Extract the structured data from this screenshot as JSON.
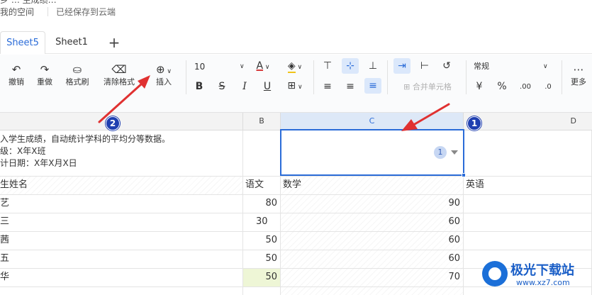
{
  "topbar": {
    "cut_text": "乡 … 生成绩…",
    "space": "我的空间",
    "saved": "已经保存到云端"
  },
  "tabs": [
    {
      "label": "Sheet5",
      "active": true
    },
    {
      "label": "Sheet1",
      "active": false
    }
  ],
  "add_tab_symbol": "+",
  "toolbar": {
    "undo": "撤销",
    "redo": "重做",
    "format_painter": "格式刷",
    "clear_format": "清除格式",
    "insert": "插入",
    "font_size": "10",
    "merge": "合并单元格",
    "number_format": "常规",
    "currency": "¥",
    "percent": "%",
    "decimal_inc": ".00",
    "decimal_dec": ".0",
    "more": "更多",
    "font_color": "#d63b3b",
    "fill_color": "#f0c419"
  },
  "columns": [
    {
      "label": "B"
    },
    {
      "label": "C"
    },
    {
      "label": "D"
    }
  ],
  "intro": [
    "入学生成绩，自动统计学科的平均分等数据。",
    "级：X年X班",
    "计日期：X年X月X日"
  ],
  "header_row": {
    "name": "生姓名",
    "chinese": "语文",
    "math": "数学",
    "english": "英语"
  },
  "rows": [
    {
      "name": "艺",
      "chinese": "80",
      "math": "90"
    },
    {
      "name": "三",
      "chinese": "30",
      "math": "60"
    },
    {
      "name": "茜",
      "chinese": "50",
      "math": "60"
    },
    {
      "name": "五",
      "chinese": "50",
      "math": "60"
    },
    {
      "name": "华",
      "chinese": "50",
      "math": "70"
    }
  ],
  "cell_badge": "1",
  "markers": {
    "one": "1",
    "two": "2"
  },
  "accent": "#2b6cd8",
  "arrow_color": "#e03131",
  "watermark": {
    "name": "极光下载站",
    "url": "www.xz7.com"
  }
}
